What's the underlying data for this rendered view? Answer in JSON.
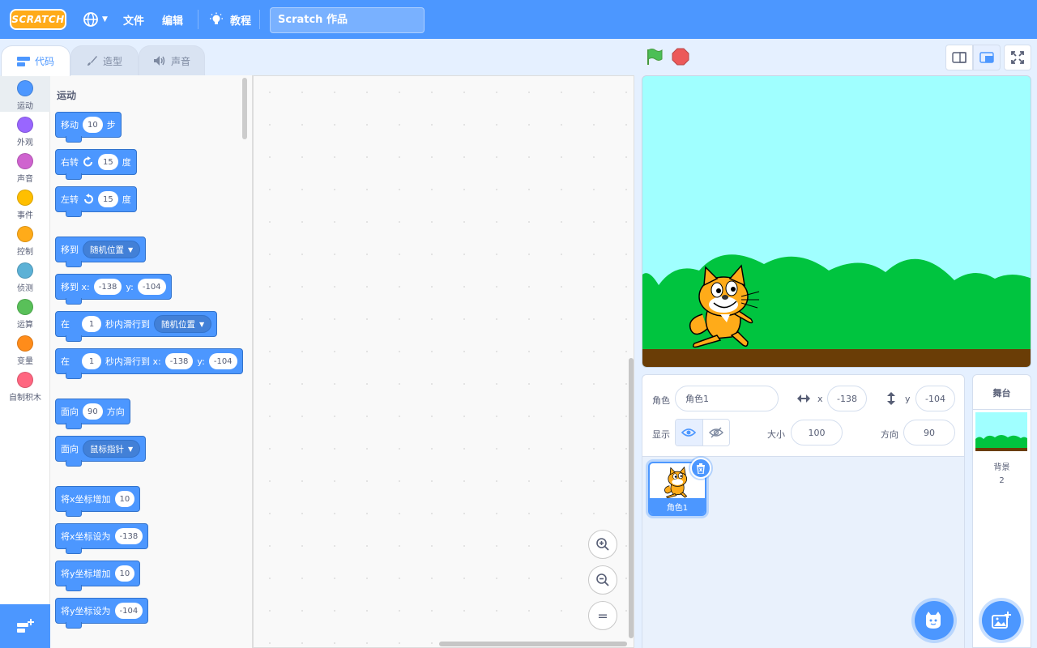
{
  "menubar": {
    "logo": "SCRATCH",
    "file": "文件",
    "edit": "编辑",
    "tutorials": "教程",
    "project_title": "Scratch 作品"
  },
  "tabs": {
    "code": "代码",
    "costumes": "造型",
    "sounds": "声音"
  },
  "categories": [
    {
      "label": "运动",
      "color": "#4c97ff"
    },
    {
      "label": "外观",
      "color": "#9966ff"
    },
    {
      "label": "声音",
      "color": "#cf63cf"
    },
    {
      "label": "事件",
      "color": "#ffbf00"
    },
    {
      "label": "控制",
      "color": "#ffab19"
    },
    {
      "label": "侦测",
      "color": "#5cb1d6"
    },
    {
      "label": "运算",
      "color": "#59c059"
    },
    {
      "label": "变量",
      "color": "#ff8c1a"
    },
    {
      "label": "自制积木",
      "color": "#ff6680"
    }
  ],
  "palette": {
    "heading": "运动",
    "move": {
      "label": "移动",
      "value": "10",
      "suffix": "步"
    },
    "turn_right": {
      "label": "右转",
      "value": "15",
      "suffix": "度"
    },
    "turn_left": {
      "label": "左转",
      "value": "15",
      "suffix": "度"
    },
    "goto": {
      "label": "移到",
      "option": "随机位置"
    },
    "goto_xy": {
      "label": "移到 x:",
      "x": "-138",
      "ylabel": "y:",
      "y": "-104"
    },
    "glide_to": {
      "label": "在",
      "secs": "1",
      "mid": "秒内滑行到",
      "option": "随机位置"
    },
    "glide_xy": {
      "label": "在",
      "secs": "1",
      "mid": "秒内滑行到 x:",
      "x": "-138",
      "ylabel": "y:",
      "y": "-104"
    },
    "point_dir": {
      "label": "面向",
      "value": "90",
      "suffix": "方向"
    },
    "point_towards": {
      "label": "面向",
      "option": "鼠标指针"
    },
    "change_x": {
      "label": "将x坐标增加",
      "value": "10"
    },
    "set_x": {
      "label": "将x坐标设为",
      "value": "-138"
    },
    "change_y": {
      "label": "将y坐标增加",
      "value": "10"
    },
    "set_y": {
      "label": "将y坐标设为",
      "value": "-104"
    }
  },
  "zoom": {
    "reset": "="
  },
  "sprite_info": {
    "sprite_label": "角色",
    "sprite_name": "角色1",
    "x_label": "x",
    "x": "-138",
    "y_label": "y",
    "y": "-104",
    "show_label": "显示",
    "size_label": "大小",
    "size": "100",
    "direction_label": "方向",
    "direction": "90"
  },
  "sprites": [
    {
      "name": "角色1"
    }
  ],
  "stage_panel": {
    "title": "舞台",
    "backdrops_label": "背景",
    "backdrops_count": "2"
  },
  "colors": {
    "accent": "#4c97ff",
    "motion": "#4c97ff",
    "menubar": "#4c97ff"
  }
}
